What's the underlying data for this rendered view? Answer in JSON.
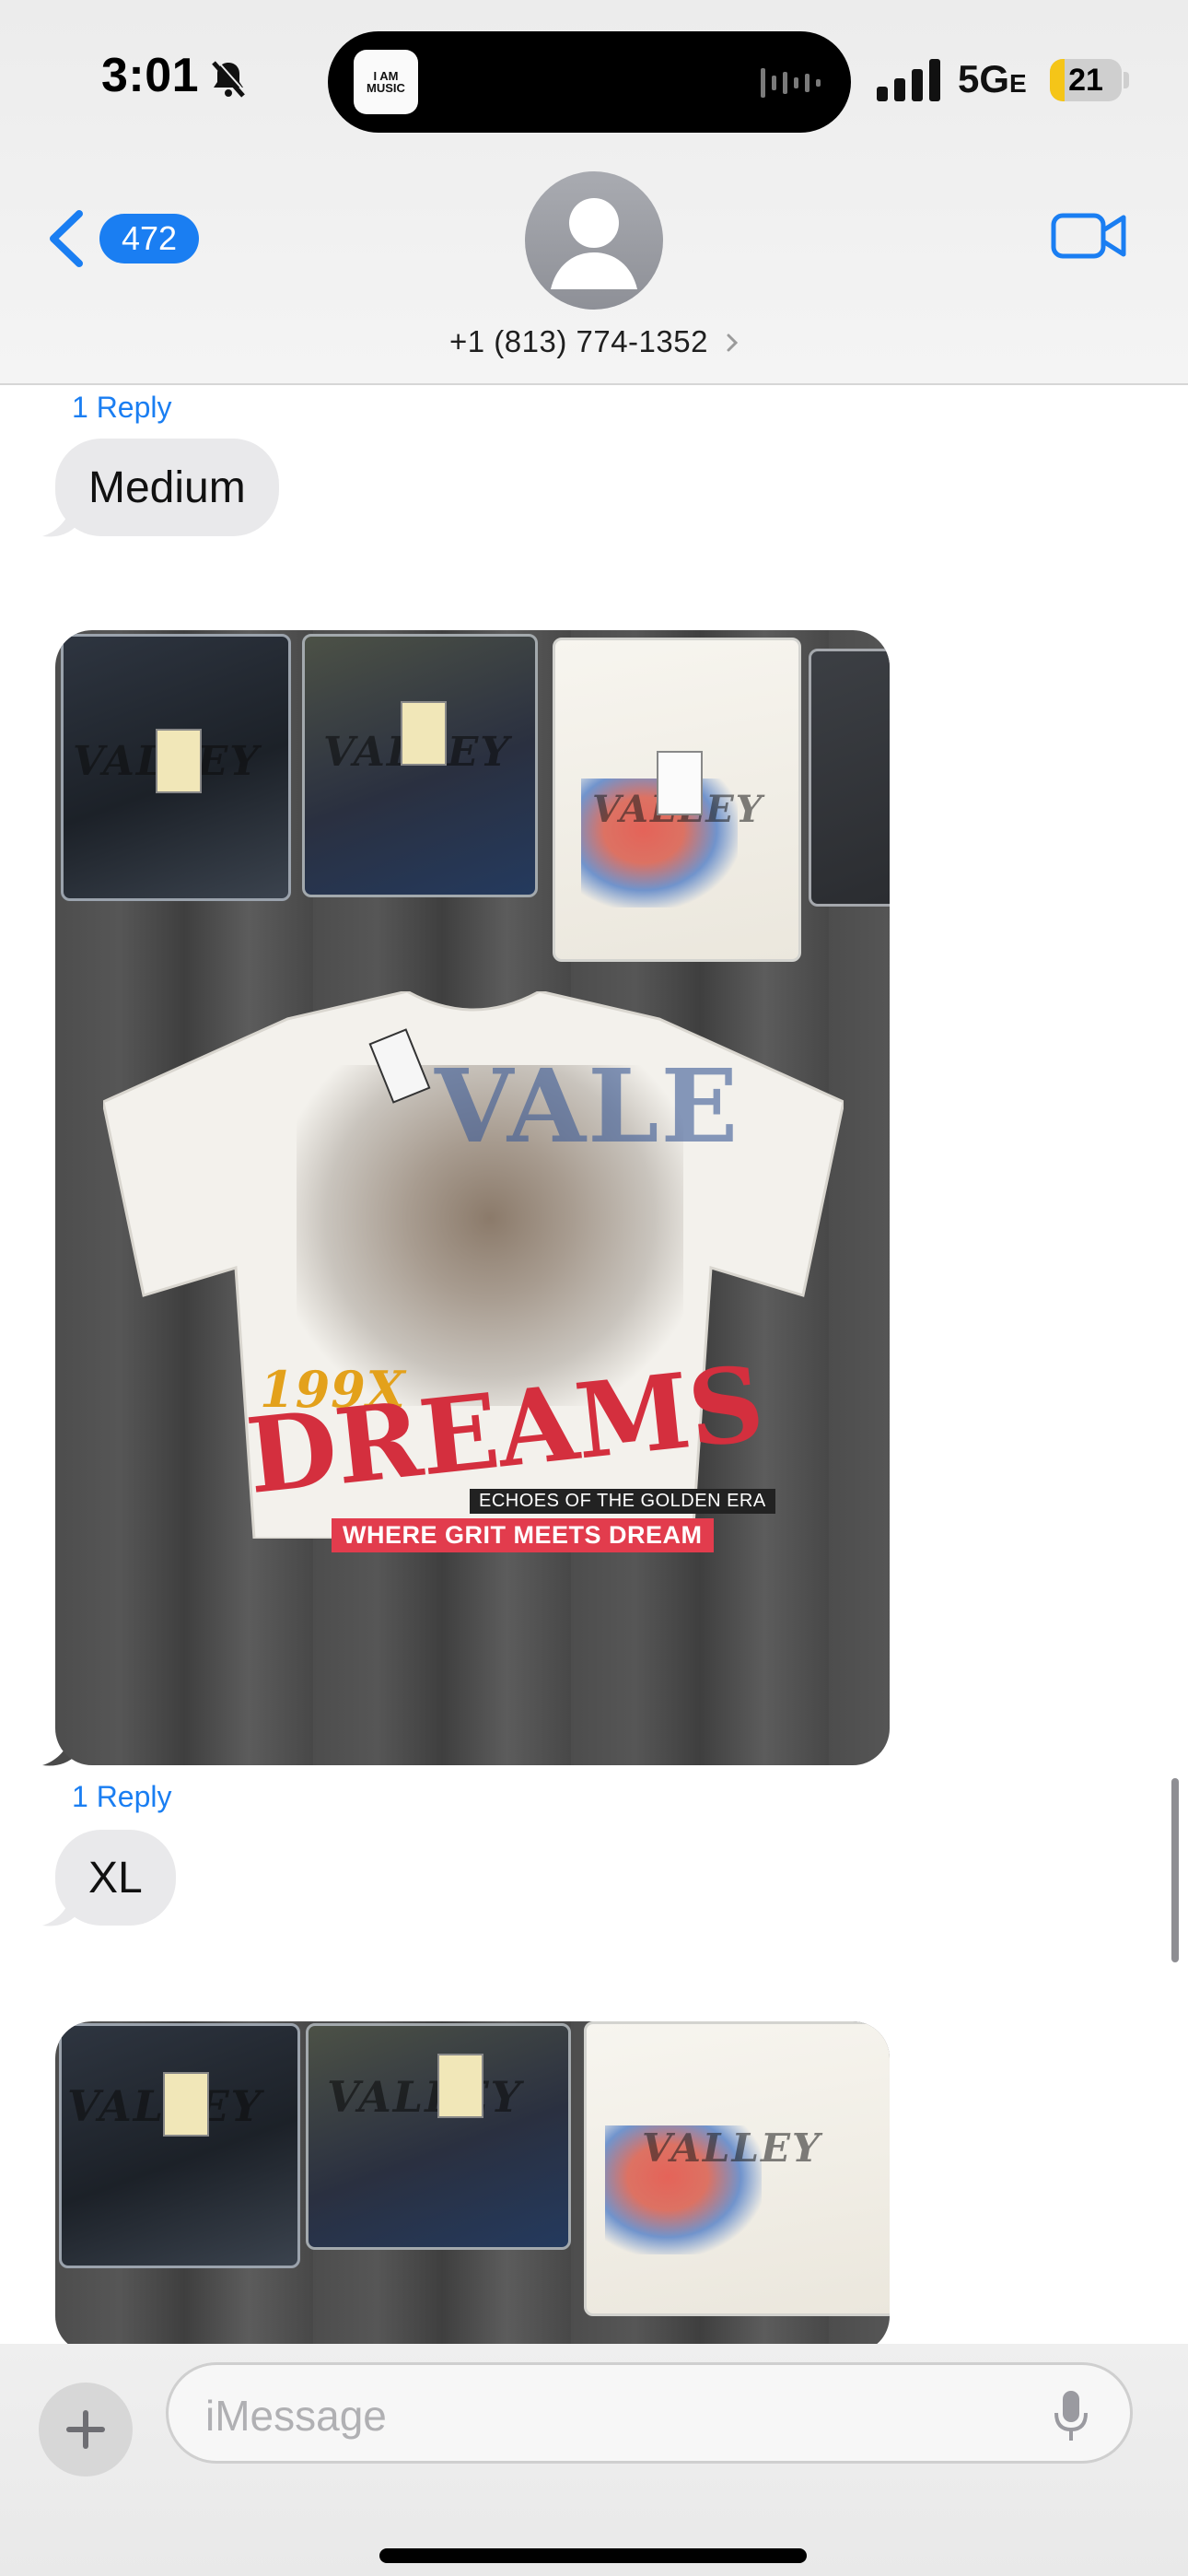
{
  "status_bar": {
    "time": "3:01",
    "now_playing_art_label": "I AM MUSIC",
    "network": "5G",
    "network_sub": "E",
    "battery_percent": 21
  },
  "nav": {
    "unread_count": "472",
    "contact": "+1 (813) 774-1352",
    "icons": [
      "chevron-left-icon",
      "contact-avatar",
      "chevron-right-icon",
      "video-camera-icon"
    ]
  },
  "conversation": {
    "reply_label_1": "1 Reply",
    "message_1": "Medium",
    "reply_label_2": "1 Reply",
    "message_2": "XL",
    "photo_1": {
      "bag_prints": [
        "VALLEY",
        "VALLEY",
        "VALLEY"
      ],
      "tee_brand": "VALE",
      "tee_year": "199X",
      "tee_title": "DREAMS",
      "tee_subtitle": "ECHOES OF THE GOLDEN ERA",
      "tee_slogan": "WHERE GRIT MEETS DREAM"
    },
    "photo_2": {
      "bag_prints": [
        "VALLEY",
        "VALLEY",
        "VALLEY"
      ]
    }
  },
  "composer": {
    "placeholder": "iMessage",
    "icons": [
      "plus-icon",
      "microphone-icon"
    ]
  },
  "colors": {
    "accent": "#1a7ef2",
    "bubble_incoming": "#e9e9eb",
    "battery_low": "#f5c518"
  }
}
